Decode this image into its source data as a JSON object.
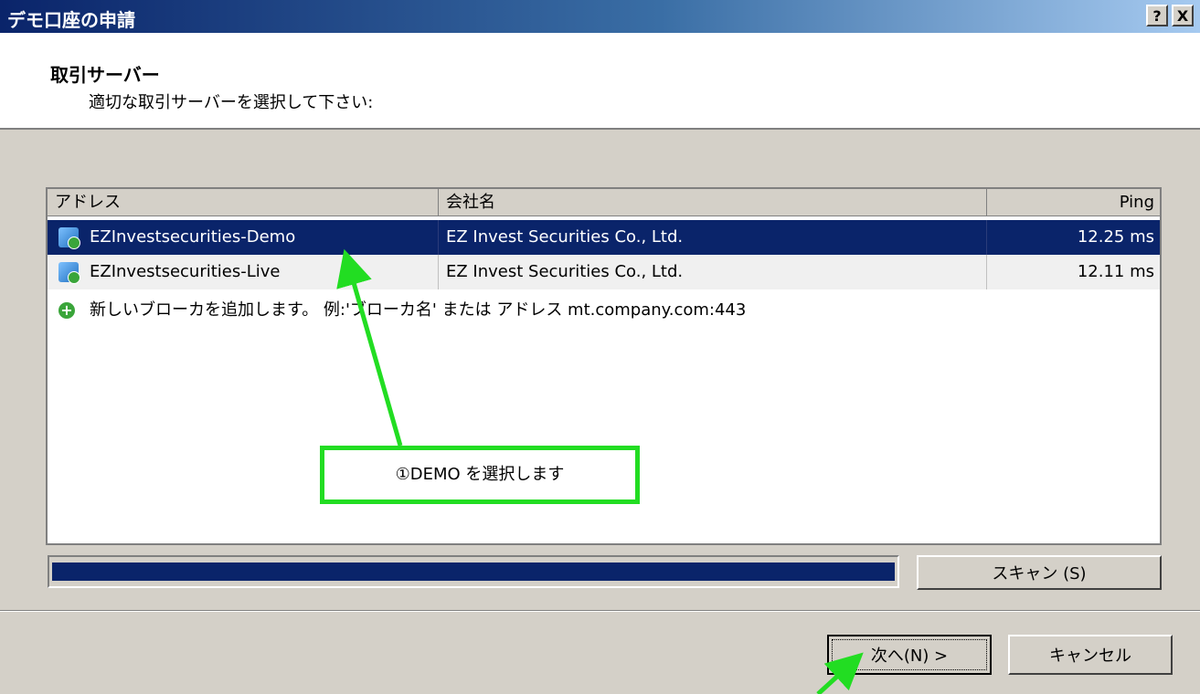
{
  "window": {
    "title": "デモ口座の申請",
    "help_label": "?",
    "close_label": "X"
  },
  "header": {
    "title": "取引サーバー",
    "subtitle": "適切な取引サーバーを選択して下さい:"
  },
  "server_list": {
    "columns": [
      "アドレス",
      "会社名",
      "Ping"
    ],
    "rows": [
      {
        "address": "EZInvestsecurities-Demo",
        "company": "EZ Invest Securities Co., Ltd.",
        "ping": "12.25 ms",
        "selected": true,
        "icon": "server-icon"
      },
      {
        "address": "EZInvestsecurities-Live",
        "company": "EZ Invest Securities Co., Ltd.",
        "ping": "12.11 ms",
        "selected": false,
        "icon": "server-icon"
      }
    ],
    "add_row": {
      "text": "新しいブローカを追加します。 例:'ブローカ名' または アドレス mt.company.com:443",
      "icon": "add-icon"
    }
  },
  "scan": {
    "progress": 1.0,
    "button_label": "スキャン (S)"
  },
  "footer": {
    "next_label": "次へ(N) >",
    "cancel_label": "キャンセル"
  },
  "annotation": {
    "callout_text": "①DEMO を選択します",
    "color": "#22dd22"
  },
  "colors": {
    "selection": "#0a246a",
    "dialog_bg": "#d4d0c8"
  }
}
